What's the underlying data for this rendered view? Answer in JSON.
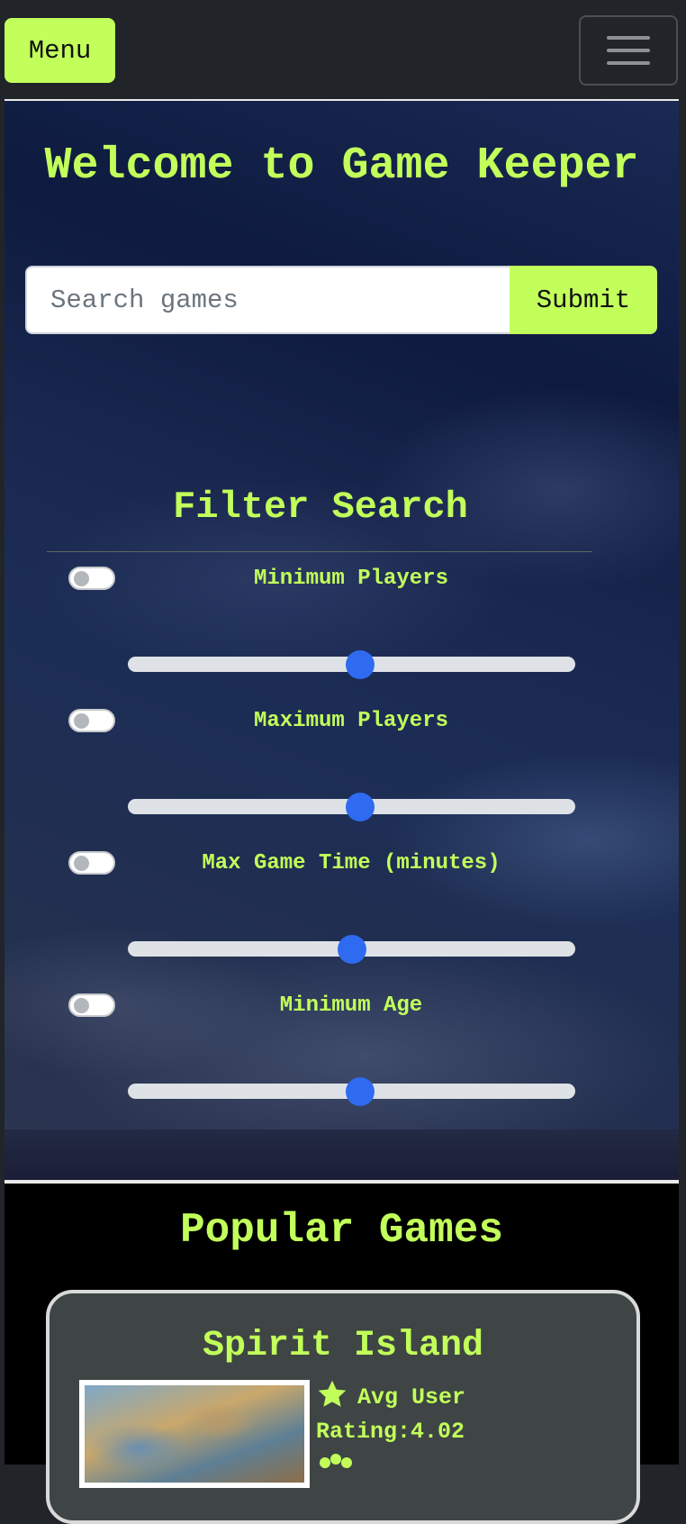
{
  "navbar": {
    "menu_label": "Menu",
    "toggler_icon": "hamburger-icon"
  },
  "hero": {
    "title": "Welcome to Game Keeper",
    "search": {
      "placeholder": "Search games",
      "value": "",
      "submit_label": "Submit"
    }
  },
  "filters": {
    "title": "Filter Search",
    "items": [
      {
        "label": "Minimum Players",
        "enabled": false,
        "slider_level": 0.52
      },
      {
        "label": "Maximum Players",
        "enabled": false,
        "slider_level": 0.52
      },
      {
        "label": "Max Game Time (minutes)",
        "enabled": false,
        "slider_level": 0.5
      },
      {
        "label": "Minimum Age",
        "enabled": false,
        "slider_level": 0.52
      }
    ]
  },
  "popular": {
    "title": "Popular Games",
    "games": [
      {
        "name": "Spirit Island",
        "rating_label": "Avg User Rating:4.02",
        "rating_icon": "star-icon",
        "players_icon": "users-icon"
      }
    ]
  },
  "colors": {
    "accent": "#c2ff5a",
    "slider_thumb": "#2f6bf0",
    "navbar_bg": "#212529",
    "card_bg": "#3e4544"
  }
}
